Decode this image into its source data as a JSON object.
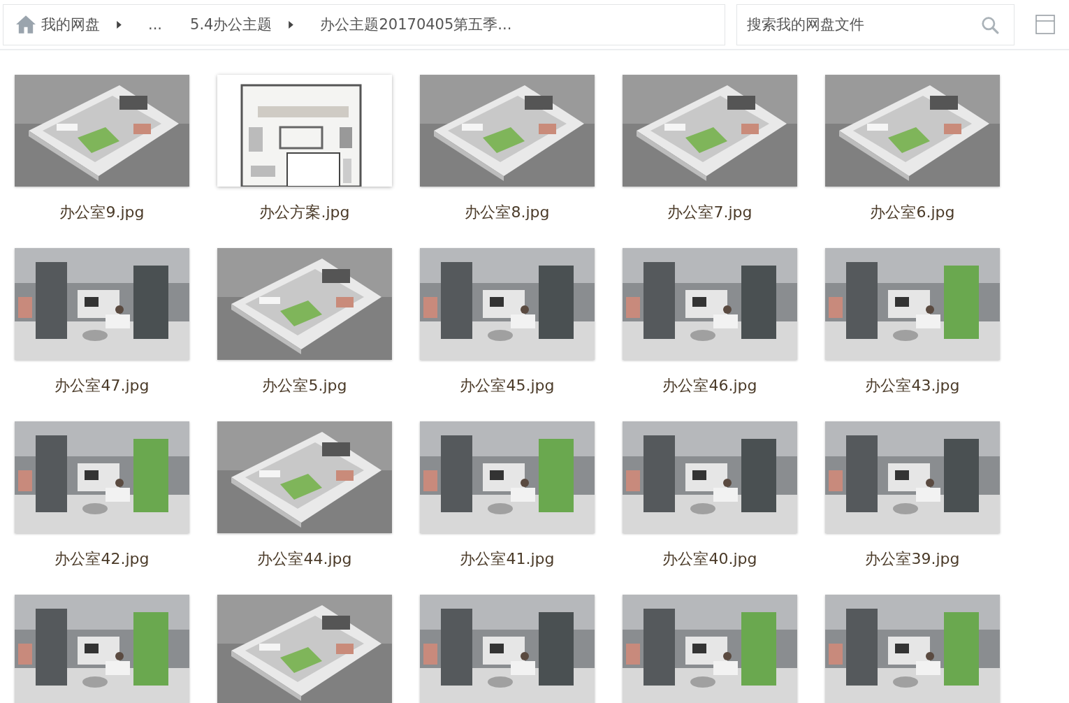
{
  "breadcrumb": {
    "home": "我的网盘",
    "items": [
      {
        "label": "..."
      },
      {
        "label": "5.4办公主题"
      },
      {
        "label": "办公主题20170405第五季..."
      }
    ]
  },
  "search": {
    "placeholder": "搜索我的网盘文件"
  },
  "files": [
    {
      "name": "办公室9.jpg",
      "thumbnail": {
        "kind": "picture"
      }
    },
    {
      "name": "办公方案.jpg",
      "thumbnail": {
        "kind": "picture"
      }
    },
    {
      "name": "办公室8.jpg",
      "thumbnail": {
        "kind": "picture"
      }
    },
    {
      "name": "办公室7.jpg",
      "thumbnail": {
        "kind": "picture"
      }
    },
    {
      "name": "办公室6.jpg",
      "thumbnail": {
        "kind": "picture"
      }
    },
    {
      "name": "办公室47.jpg",
      "thumbnail": {
        "kind": "picture"
      }
    },
    {
      "name": "办公室5.jpg",
      "thumbnail": {
        "kind": "picture"
      }
    },
    {
      "name": "办公室45.jpg",
      "thumbnail": {
        "kind": "picture"
      }
    },
    {
      "name": "办公室46.jpg",
      "thumbnail": {
        "kind": "picture"
      }
    },
    {
      "name": "办公室43.jpg",
      "thumbnail": {
        "kind": "picture"
      }
    },
    {
      "name": "办公室42.jpg",
      "thumbnail": {
        "kind": "picture"
      }
    },
    {
      "name": "办公室44.jpg",
      "thumbnail": {
        "kind": "picture"
      }
    },
    {
      "name": "办公室41.jpg",
      "thumbnail": {
        "kind": "picture"
      }
    },
    {
      "name": "办公室40.jpg",
      "thumbnail": {
        "kind": "picture"
      }
    },
    {
      "name": "办公室39.jpg",
      "thumbnail": {
        "kind": "picture"
      }
    },
    {
      "thumbnail": {
        "kind": "picture"
      }
    },
    {
      "thumbnail": {
        "kind": "picture"
      }
    },
    {
      "thumbnail": {
        "kind": "picture"
      }
    },
    {
      "thumbnail": {
        "kind": "picture"
      }
    },
    {
      "thumbnail": {
        "kind": "picture"
      }
    }
  ]
}
